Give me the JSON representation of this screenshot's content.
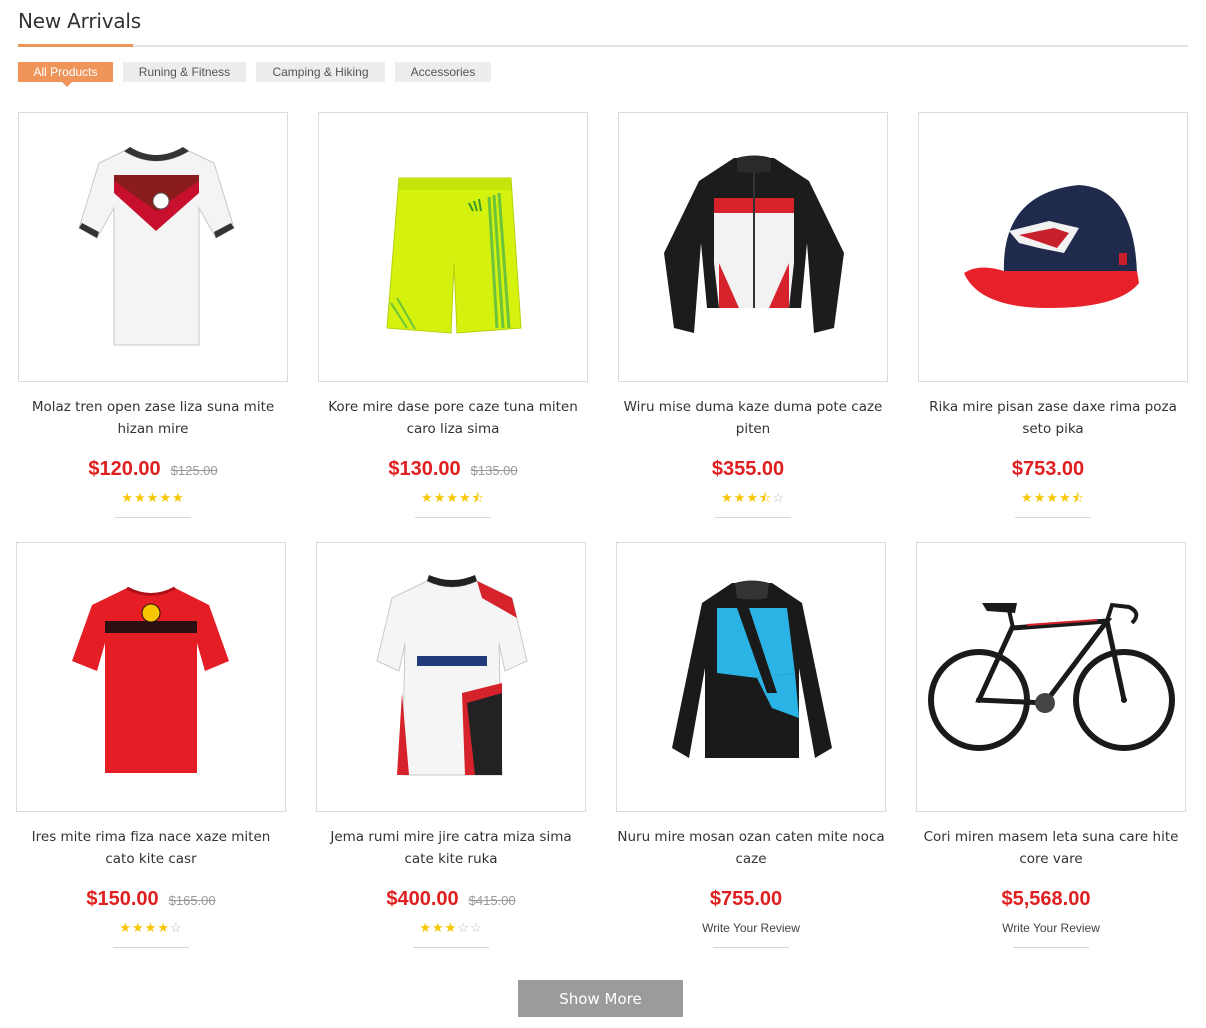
{
  "section": {
    "title": "New Arrivals"
  },
  "tabs": [
    {
      "label": "All Products",
      "active": true
    },
    {
      "label": "Runing & Fitness",
      "active": false
    },
    {
      "label": "Camping & Hiking",
      "active": false
    },
    {
      "label": "Accessories",
      "active": false
    }
  ],
  "products": [
    {
      "name": "Molaz tren open zase liza suna mite hizan mire",
      "price": "$120.00",
      "old_price": "$125.00",
      "rating": 5,
      "image": "germany-jersey"
    },
    {
      "name": "Kore mire dase pore caze tuna miten caro liza sima",
      "price": "$130.00",
      "old_price": "$135.00",
      "rating": 4.5,
      "image": "neon-shorts"
    },
    {
      "name": "Wiru mise duma kaze duma pote caze piten",
      "price": "$355.00",
      "old_price": "",
      "rating": 3.5,
      "image": "moto-jacket"
    },
    {
      "name": "Rika mire pisan zase daxe rima poza seto pika",
      "price": "$753.00",
      "old_price": "",
      "rating": 4.5,
      "image": "patriots-cap"
    },
    {
      "name": "Ires mite rima fiza nace xaze miten cato kite casr",
      "price": "$150.00",
      "old_price": "$165.00",
      "rating": 4,
      "image": "red-tshirt"
    },
    {
      "name": "Jema rumi mire jire catra miza sima cate kite ruka",
      "price": "$400.00",
      "old_price": "$415.00",
      "rating": 3,
      "image": "rugby-jersey"
    },
    {
      "name": "Nuru mire mosan ozan caten mite noca caze",
      "price": "$755.00",
      "old_price": "",
      "rating": null,
      "review_label": "Write Your Review",
      "image": "cycling-jacket"
    },
    {
      "name": "Cori miren masem leta suna care hite core vare",
      "price": "$5,568.00",
      "old_price": "",
      "rating": null,
      "review_label": "Write Your Review",
      "image": "road-bike"
    }
  ],
  "show_more_label": "Show More",
  "colors": {
    "accent": "#f0955a",
    "price": "#e02020",
    "star": "#f7c600",
    "button": "#9b9b9b"
  }
}
